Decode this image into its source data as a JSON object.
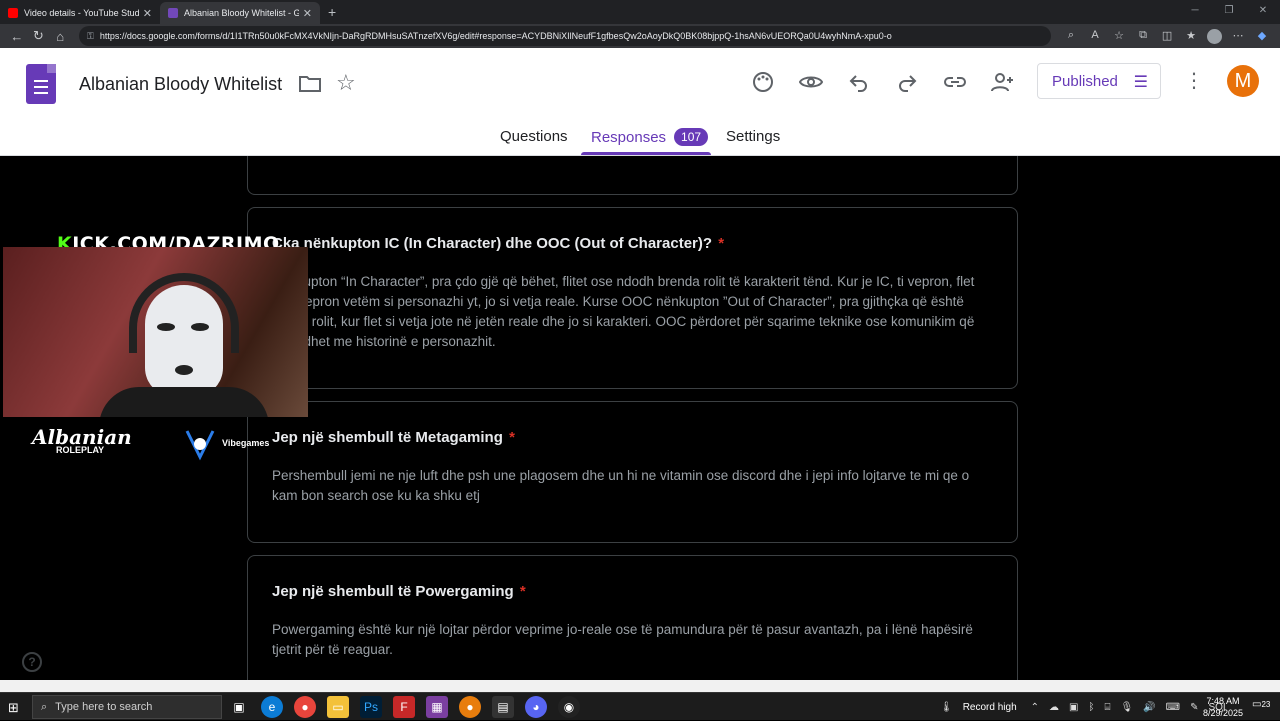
{
  "browser": {
    "tabs": [
      {
        "title": "Video details - YouTube Studio",
        "active": false,
        "favicon_color": "#ff0000"
      },
      {
        "title": "Albanian Bloody Whitelist - Goog",
        "active": true,
        "favicon_color": "#7248b9"
      }
    ],
    "url": "https://docs.google.com/forms/d/1I1TRn50u0kFcMX4VkNIjn-DaRgRDMHsuSATnzefXV6g/edit#response=ACYDBNiXIlNeufF1gfbesQw2oAoyDkQ0BK08bjppQ-1hsAN6vUEORQa0U4wyhNmA-xpu0-o"
  },
  "form": {
    "title": "Albanian Bloody Whitelist",
    "published_label": "Published",
    "avatar_letter": "M",
    "tabs": {
      "questions": "Questions",
      "responses": "Responses",
      "responses_count": "107",
      "settings": "Settings"
    },
    "cards": [
      {
        "question": "Çka nënkupton IC (In Character) dhe OOC (Out of Character)?",
        "required": "*",
        "answer": "Nënkupton “In Character”, pra çdo gjë që bëhet, flitet ose ndodh brenda rolit të karakterit tënd. Kur je IC, ti vepron, flet dhe vepron vetëm si personazhi yt, jo si vetja reale. Kurse OOC nënkupton ”Out of Character”, pra gjithçka që është jashtë rolit, kur flet si vetja jote në jetën reale dhe jo si karakteri. OOC përdoret për sqarime teknike ose komunikim që nuk lidhet me historinë e personazhit."
      },
      {
        "question": "Jep një shembull të Metagaming",
        "required": "*",
        "answer": "Pershembull jemi ne nje luft dhe psh une plagosem dhe un hi ne vitamin ose discord dhe i jepi info lojtarve te mi qe o kam bon search ose ku ka shku etj"
      },
      {
        "question": "Jep një shembull të Powergaming",
        "required": "*",
        "answer": "Powergaming është kur një lojtar përdor veprime jo-reale ose të pamundura për të pasur avantazh, pa i lënë hapësirë tjetrit për të reaguar."
      }
    ]
  },
  "overlay": {
    "kick_k": "K",
    "kick_rest": "ICK.COM/DAZRIMO",
    "albanian_logo": "Albanian",
    "roleplay": "ROLEPLAY",
    "vibegames": "Vibegames"
  },
  "taskbar": {
    "search_placeholder": "Type here to search",
    "record_label": "Record high",
    "language": "SQI",
    "time": "7:48 AM",
    "date": "8/29/2025",
    "notifications": "23"
  },
  "colors": {
    "forms_purple": "#673ab7",
    "required_red": "#d93025",
    "avatar_orange": "#e8710a",
    "kick_green": "#53fc18"
  }
}
